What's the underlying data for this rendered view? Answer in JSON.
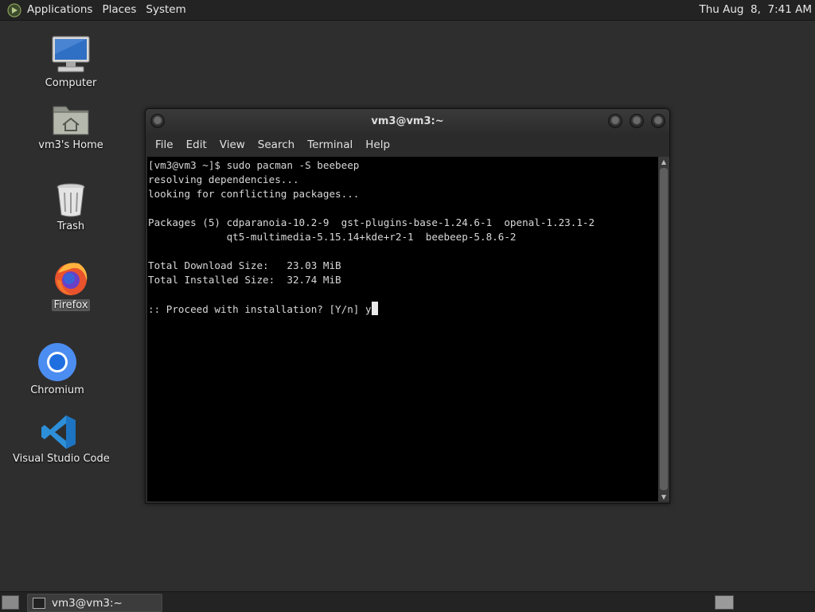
{
  "top_panel": {
    "menus": [
      "Applications",
      "Places",
      "System"
    ],
    "clock": "Thu Aug  8,  7:41 AM"
  },
  "desktop": {
    "icons": [
      {
        "label": "Computer",
        "icon": "computer-icon"
      },
      {
        "label": "vm3's Home",
        "icon": "home-folder-icon"
      },
      {
        "label": "Trash",
        "icon": "trash-icon"
      },
      {
        "label": "Firefox",
        "icon": "firefox-icon",
        "selected": true
      },
      {
        "label": "Chromium",
        "icon": "chromium-icon"
      },
      {
        "label": "Visual Studio Code",
        "icon": "vscode-icon"
      }
    ]
  },
  "terminal": {
    "title": "vm3@vm3:~",
    "menu": [
      "File",
      "Edit",
      "View",
      "Search",
      "Terminal",
      "Help"
    ],
    "lines": [
      "[vm3@vm3 ~]$ sudo pacman -S beebeep",
      "resolving dependencies...",
      "looking for conflicting packages...",
      "",
      "Packages (5) cdparanoia-10.2-9  gst-plugins-base-1.24.6-1  openal-1.23.1-2",
      "             qt5-multimedia-5.15.14+kde+r2-1  beebeep-5.8.6-2",
      "",
      "Total Download Size:   23.03 MiB",
      "Total Installed Size:  32.74 MiB",
      ""
    ],
    "prompt_line": ":: Proceed with installation? [Y/n] y"
  },
  "taskbar": {
    "window_label": "vm3@vm3:~"
  },
  "colors": {
    "desktop_bg": "#2e2e2e",
    "panel_bg": "#232323",
    "terminal_bg": "#000000",
    "terminal_fg": "#d8d8d8"
  }
}
